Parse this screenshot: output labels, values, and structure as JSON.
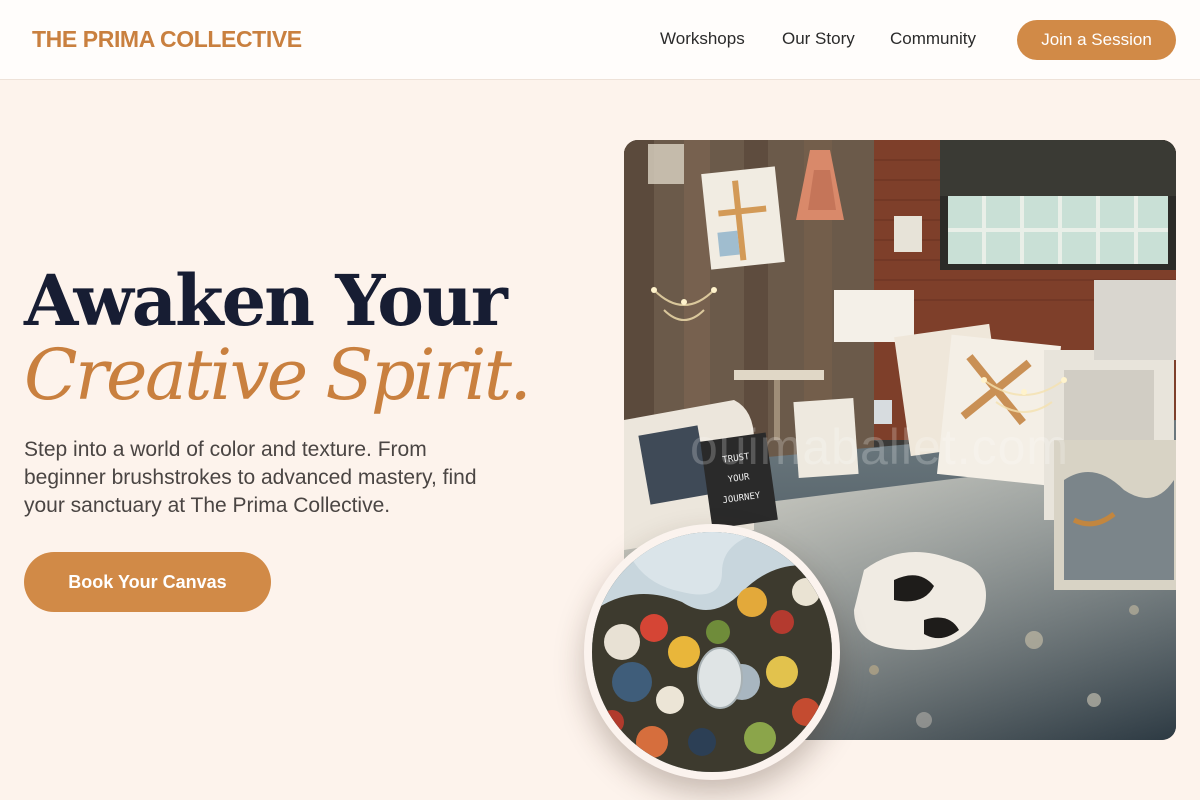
{
  "header": {
    "brand": "THE PRIMA COLLECTIVE",
    "nav": [
      {
        "label": "Workshops"
      },
      {
        "label": "Our Story"
      },
      {
        "label": "Community"
      }
    ],
    "cta_label": "Join a Session"
  },
  "hero": {
    "title_line1": "Awaken Your",
    "title_line2": "Creative Spirit.",
    "subtitle": "Step into a world of color and texture. From beginner brushstrokes to advanced mastery, find your sanctuary at The Prima Collective.",
    "cta_label": "Book Your Canvas"
  },
  "images": {
    "studio_watermark": "ouimaballet.com",
    "canvas_sign": "TRUST YOUR JOURNEY"
  },
  "colors": {
    "accent": "#d18a47",
    "brand_text": "#c9803f",
    "heading": "#171d33",
    "background": "#fdf3ec"
  }
}
